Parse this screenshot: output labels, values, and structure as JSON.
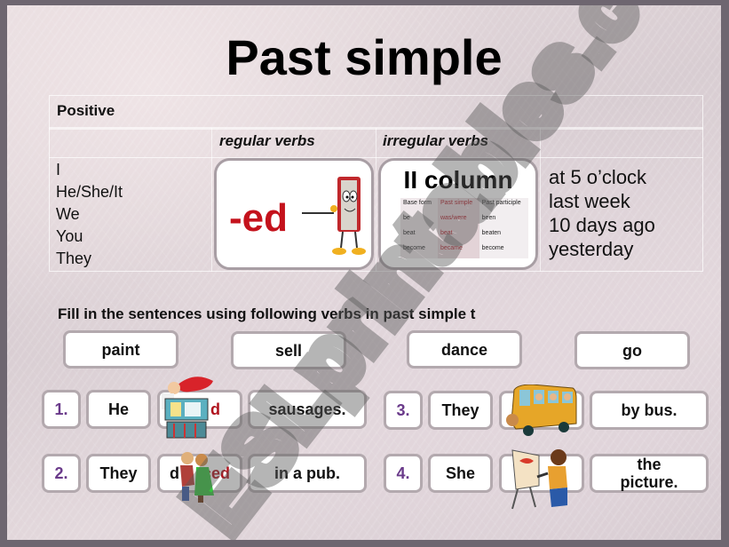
{
  "slide": {
    "title": "Past simple",
    "table": {
      "header": "Positive",
      "columns": [
        "",
        "regular verbs",
        "irregular verbs",
        ""
      ],
      "subjects": [
        "I",
        "He/She/It",
        "We",
        "You",
        "They"
      ],
      "regular_card": {
        "suffix": "-ed",
        "icon": "book-teacher-pointer-icon"
      },
      "irregular_card": {
        "title": "II column",
        "mini_table": {
          "rows": [
            [
              "Base form",
              "Past simple",
              "Past participle"
            ],
            [
              "be",
              "was/were",
              "been"
            ],
            [
              "beat",
              "beat",
              "beaten"
            ],
            [
              "become",
              "became",
              "become"
            ]
          ]
        }
      },
      "time_expressions": [
        "at 5 o’clock",
        "last week",
        "10 days ago",
        "yesterday"
      ]
    },
    "exercise": {
      "instruction": "Fill in the sentences using following verbs in past simple t",
      "verbs": [
        "paint",
        "sell",
        "dance",
        "go"
      ],
      "sentences": [
        {
          "number": "1.",
          "subject": "He",
          "answer": "d",
          "rest": "sausages.",
          "picture": "sausage-vendor-icon"
        },
        {
          "number": "2.",
          "subject": "They",
          "answer_prefix": "d",
          "answer_suffix": "ced",
          "rest": "in a pub.",
          "picture": "dancing-couple-icon"
        },
        {
          "number": "3.",
          "subject": "They",
          "answer": "",
          "rest": "by bus.",
          "picture": "school-bus-icon"
        },
        {
          "number": "4.",
          "subject": "She",
          "answer": "",
          "rest": "the picture.",
          "picture": "painter-easel-icon"
        }
      ]
    },
    "watermark": "ESLprintables.com",
    "colors": {
      "answer_red": "#b0121c",
      "number_purple": "#6a3a8a",
      "ed_red": "#c4121c"
    }
  }
}
